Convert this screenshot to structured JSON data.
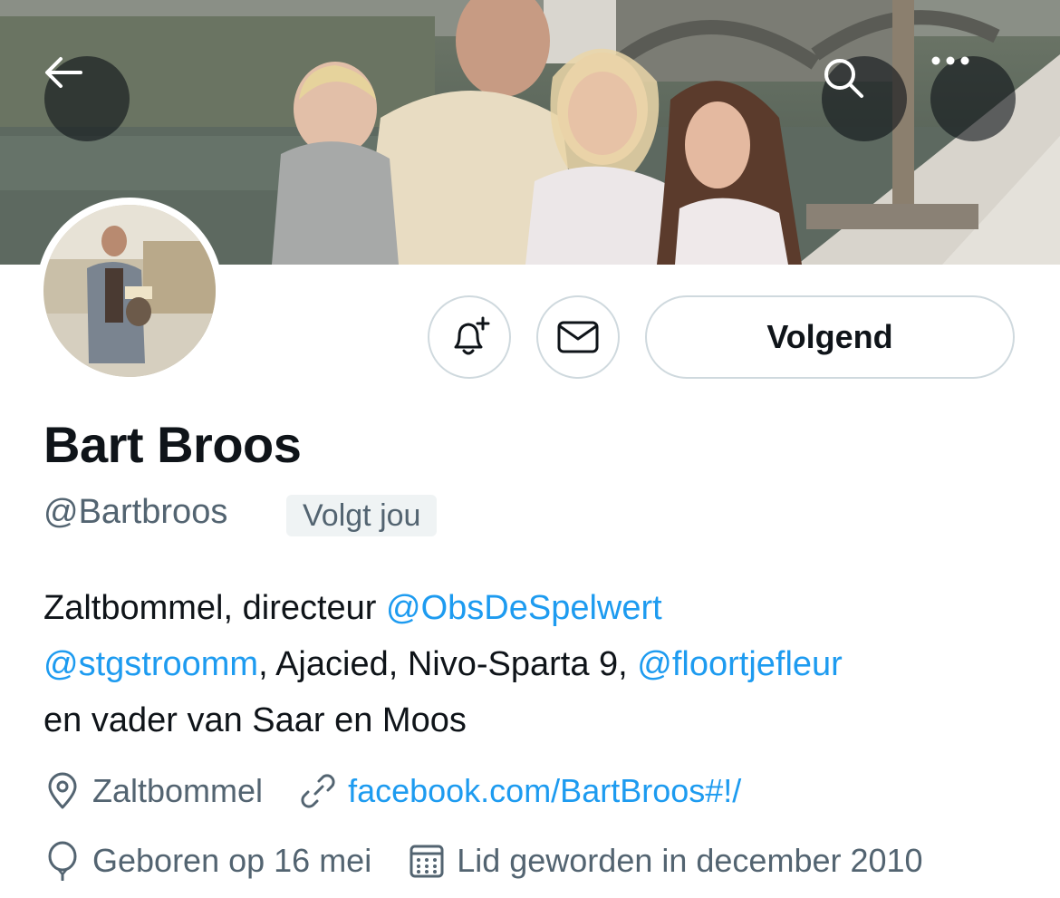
{
  "banner": {
    "description_icon": "family-photo"
  },
  "nav": {
    "back_icon": "arrow-left-icon",
    "search_icon": "search-icon",
    "more_icon": "more-icon"
  },
  "actions": {
    "notify_icon": "bell-plus-icon",
    "message_icon": "envelope-icon",
    "follow_label": "Volgend"
  },
  "profile": {
    "name": "Bart Broos",
    "handle": "@Bartbroos",
    "follows_you": "Volgt jou",
    "bio": {
      "line1_text": "Zaltbommel, directeur ",
      "line1_link": "@ObsDeSpelwert",
      "line2_link1": "@stgstroomm",
      "line2_text": ", Ajacied, Nivo-Sparta 9, ",
      "line2_link2": "@floortjefleur",
      "line3_text": "en vader van Saar en Moos"
    },
    "location": "Zaltbommel",
    "website": "facebook.com/BartBroos#!/",
    "birthday": "Geboren op 16 mei",
    "joined": "Lid geworden in december 2010"
  },
  "colors": {
    "link": "#1d9bf0",
    "secondary": "#536471",
    "border": "#cfd9de",
    "text": "#0f1419"
  }
}
